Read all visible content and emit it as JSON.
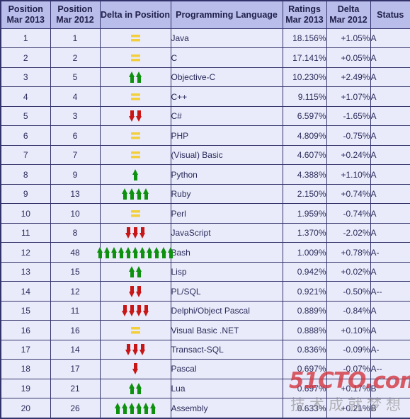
{
  "table": {
    "headers": [
      {
        "key": "pos2013",
        "line1": "Position",
        "line2": "Mar 2013"
      },
      {
        "key": "pos2012",
        "line1": "Position",
        "line2": "Mar 2012"
      },
      {
        "key": "delta_position",
        "line1": "Delta in Position",
        "line2": ""
      },
      {
        "key": "language",
        "line1": "Programming Language",
        "line2": ""
      },
      {
        "key": "ratings",
        "line1": "Ratings",
        "line2": "Mar 2013"
      },
      {
        "key": "delta_ratings",
        "line1": "Delta",
        "line2": "Mar 2012"
      },
      {
        "key": "status",
        "line1": "Status",
        "line2": ""
      }
    ],
    "rows": [
      {
        "pos2013": "1",
        "pos2012": "1",
        "delta_icon": "equal",
        "delta_count": 1,
        "language": "Java",
        "ratings": "18.156%",
        "delta_ratings": "+1.05%",
        "status": "A"
      },
      {
        "pos2013": "2",
        "pos2012": "2",
        "delta_icon": "equal",
        "delta_count": 1,
        "language": "C",
        "ratings": "17.141%",
        "delta_ratings": "+0.05%",
        "status": "A"
      },
      {
        "pos2013": "3",
        "pos2012": "5",
        "delta_icon": "arrow-up",
        "delta_count": 2,
        "language": "Objective-C",
        "ratings": "10.230%",
        "delta_ratings": "+2.49%",
        "status": "A"
      },
      {
        "pos2013": "4",
        "pos2012": "4",
        "delta_icon": "equal",
        "delta_count": 1,
        "language": "C++",
        "ratings": "9.115%",
        "delta_ratings": "+1.07%",
        "status": "A"
      },
      {
        "pos2013": "5",
        "pos2012": "3",
        "delta_icon": "arrow-down",
        "delta_count": 2,
        "language": "C#",
        "ratings": "6.597%",
        "delta_ratings": "-1.65%",
        "status": "A"
      },
      {
        "pos2013": "6",
        "pos2012": "6",
        "delta_icon": "equal",
        "delta_count": 1,
        "language": "PHP",
        "ratings": "4.809%",
        "delta_ratings": "-0.75%",
        "status": "A"
      },
      {
        "pos2013": "7",
        "pos2012": "7",
        "delta_icon": "equal",
        "delta_count": 1,
        "language": "(Visual) Basic",
        "ratings": "4.607%",
        "delta_ratings": "+0.24%",
        "status": "A"
      },
      {
        "pos2013": "8",
        "pos2012": "9",
        "delta_icon": "arrow-up",
        "delta_count": 1,
        "language": "Python",
        "ratings": "4.388%",
        "delta_ratings": "+1.10%",
        "status": "A"
      },
      {
        "pos2013": "9",
        "pos2012": "13",
        "delta_icon": "arrow-up",
        "delta_count": 4,
        "language": "Ruby",
        "ratings": "2.150%",
        "delta_ratings": "+0.74%",
        "status": "A"
      },
      {
        "pos2013": "10",
        "pos2012": "10",
        "delta_icon": "equal",
        "delta_count": 1,
        "language": "Perl",
        "ratings": "1.959%",
        "delta_ratings": "-0.74%",
        "status": "A"
      },
      {
        "pos2013": "11",
        "pos2012": "8",
        "delta_icon": "arrow-down",
        "delta_count": 3,
        "language": "JavaScript",
        "ratings": "1.370%",
        "delta_ratings": "-2.02%",
        "status": "A"
      },
      {
        "pos2013": "12",
        "pos2012": "48",
        "delta_icon": "arrow-up",
        "delta_count": 11,
        "language": "Bash",
        "ratings": "1.009%",
        "delta_ratings": "+0.78%",
        "status": "A-"
      },
      {
        "pos2013": "13",
        "pos2012": "15",
        "delta_icon": "arrow-up",
        "delta_count": 2,
        "language": "Lisp",
        "ratings": "0.942%",
        "delta_ratings": "+0.02%",
        "status": "A"
      },
      {
        "pos2013": "14",
        "pos2012": "12",
        "delta_icon": "arrow-down",
        "delta_count": 2,
        "language": "PL/SQL",
        "ratings": "0.921%",
        "delta_ratings": "-0.50%",
        "status": "A--"
      },
      {
        "pos2013": "15",
        "pos2012": "11",
        "delta_icon": "arrow-down",
        "delta_count": 4,
        "language": "Delphi/Object Pascal",
        "ratings": "0.889%",
        "delta_ratings": "-0.84%",
        "status": "A"
      },
      {
        "pos2013": "16",
        "pos2012": "16",
        "delta_icon": "equal",
        "delta_count": 1,
        "language": "Visual Basic .NET",
        "ratings": "0.888%",
        "delta_ratings": "+0.10%",
        "status": "A"
      },
      {
        "pos2013": "17",
        "pos2012": "14",
        "delta_icon": "arrow-down",
        "delta_count": 3,
        "language": "Transact-SQL",
        "ratings": "0.836%",
        "delta_ratings": "-0.09%",
        "status": "A-"
      },
      {
        "pos2013": "18",
        "pos2012": "17",
        "delta_icon": "arrow-down",
        "delta_count": 1,
        "language": "Pascal",
        "ratings": "0.697%",
        "delta_ratings": "-0.07%",
        "status": "A--"
      },
      {
        "pos2013": "19",
        "pos2012": "21",
        "delta_icon": "arrow-up",
        "delta_count": 2,
        "language": "Lua",
        "ratings": "0.697%",
        "delta_ratings": "+0.17%",
        "status": "B"
      },
      {
        "pos2013": "20",
        "pos2012": "26",
        "delta_icon": "arrow-up",
        "delta_count": 6,
        "language": "Assembly",
        "ratings": "0.633%",
        "delta_ratings": "+0.21%",
        "status": "B"
      }
    ]
  },
  "watermark": {
    "main": "51CTO.com",
    "sub": "技术成就梦想"
  },
  "colors": {
    "header_bg": "#b9bdea",
    "cell_bg": "#e9ebfa",
    "border": "#33336b",
    "text": "#2a2a5a",
    "arrow_up": "#0f9110",
    "arrow_down": "#c81515",
    "equal": "#f3cf3b",
    "watermark_main": "#d3323c",
    "watermark_sub": "#8c8c8c"
  }
}
